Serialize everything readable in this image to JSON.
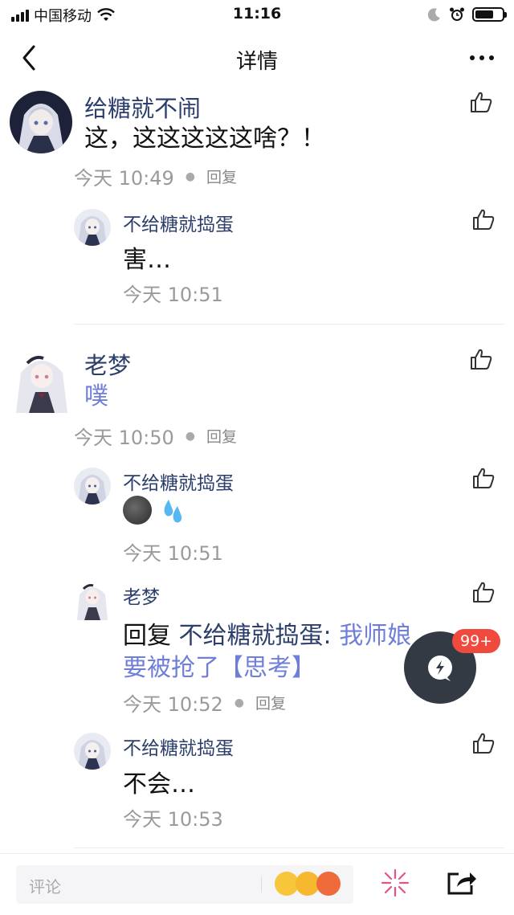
{
  "status_bar": {
    "carrier": "中国移动",
    "time": "11:16"
  },
  "nav": {
    "title": "详情"
  },
  "comment": {
    "user": "给糖就不闹",
    "text": "这，这这这这这啥？！",
    "time": "今天 10:49",
    "reply_label": "回复",
    "replies": [
      {
        "user": "不给糖就捣蛋",
        "text": "害…",
        "time": "今天 10:51"
      }
    ]
  },
  "comment2": {
    "user": "老梦",
    "text": "噗",
    "time": "今天 10:50",
    "reply_label": "回复",
    "replies": [
      {
        "user": "不给糖就捣蛋",
        "text": "🌚💦",
        "time": "今天 10:51"
      },
      {
        "user": "老梦",
        "prefix": "回复 ",
        "mention": "不给糖就捣蛋:",
        "text_line1": "我师娘",
        "text_line2": "要被抢了【思考】",
        "time": "今天 10:52",
        "reply_label": "回复"
      },
      {
        "user": "不给糖就捣蛋",
        "text": "不会…",
        "time": "今天 10:53"
      }
    ]
  },
  "floating": {
    "badge": "99+"
  },
  "bottom_bar": {
    "comment_placeholder": "评论"
  },
  "colors": {
    "username": "#2c3e6b",
    "link": "#6f7fd9",
    "badge": "#f04a3e",
    "float_button": "#333a44"
  }
}
